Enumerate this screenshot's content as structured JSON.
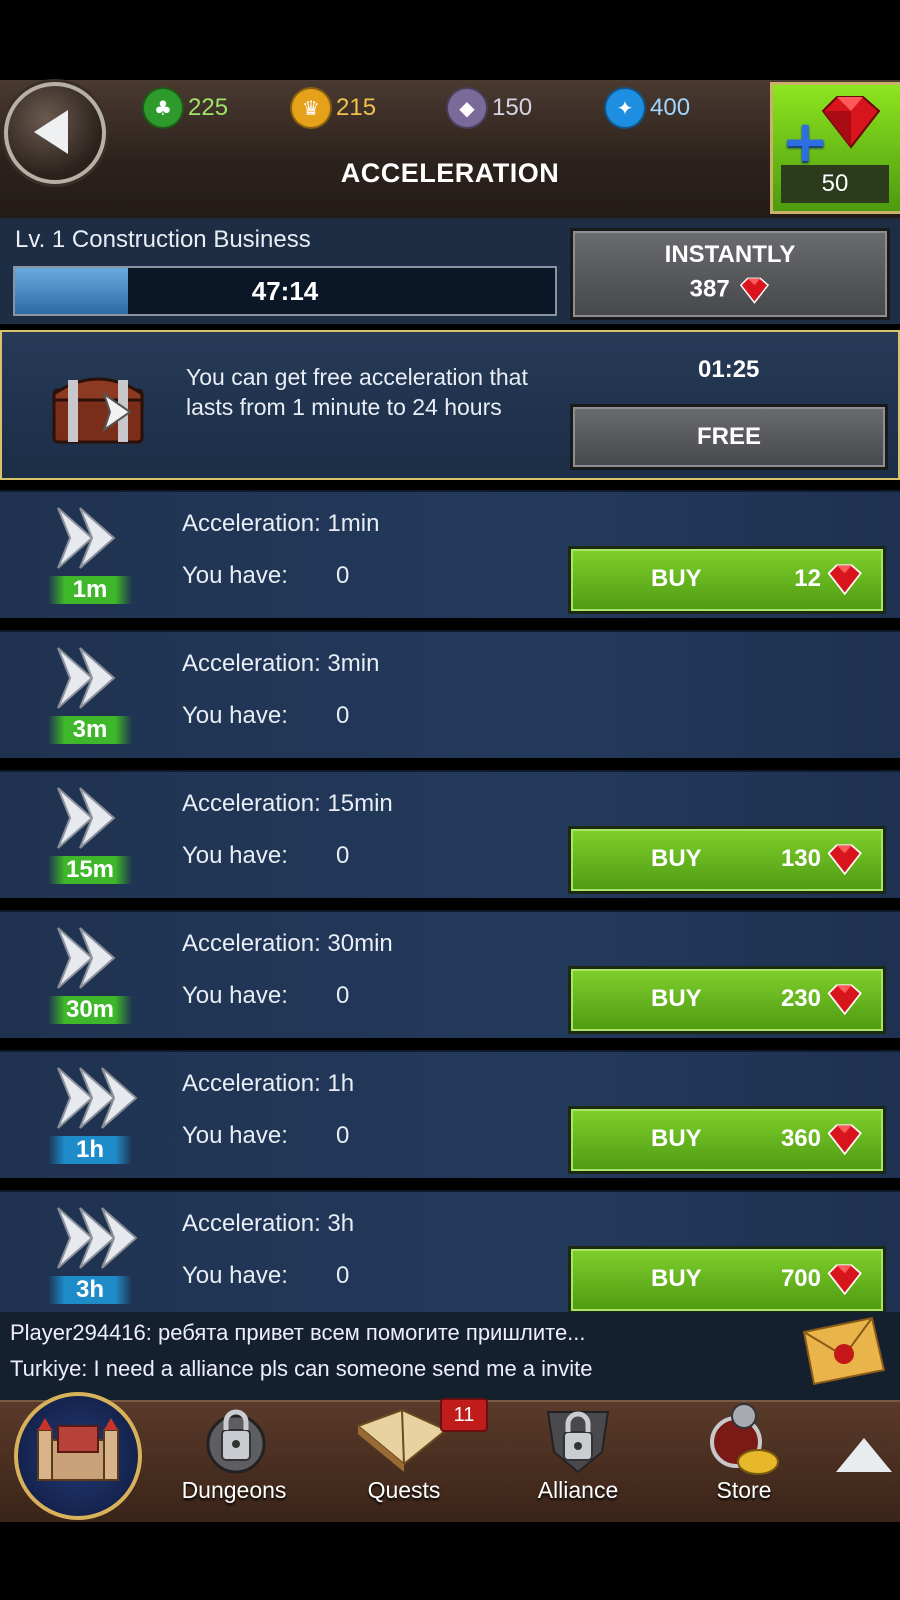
{
  "header": {
    "title": "ACCELERATION",
    "resources": [
      {
        "name": "wood",
        "icon": "tree-icon",
        "value": "225",
        "color": "#2e9a2b"
      },
      {
        "name": "gold",
        "icon": "crown-icon",
        "value": "215",
        "color": "#e6a11a"
      },
      {
        "name": "stone",
        "icon": "crystal-icon",
        "value": "150",
        "color": "#7a6a9a"
      },
      {
        "name": "mana",
        "icon": "star-icon",
        "value": "400",
        "color": "#1e8ee0"
      }
    ],
    "gems": "50"
  },
  "progress": {
    "label": "Lv. 1 Construction Business",
    "time": "47:14",
    "fill": 0.21,
    "instant_label": "INSTANTLY",
    "instant_cost": "387"
  },
  "free": {
    "text": "You can get free acceleration that lasts from 1 minute to 24 hours",
    "timer": "01:25",
    "button": "FREE"
  },
  "rows": [
    {
      "tag": "1m",
      "tag_color": "green",
      "name": "Acceleration: 1min",
      "have_label": "You have:",
      "have": "0",
      "buy": "BUY",
      "price": "12",
      "show_buy": true
    },
    {
      "tag": "3m",
      "tag_color": "green",
      "name": "Acceleration: 3min",
      "have_label": "You have:",
      "have": "0",
      "buy": "",
      "price": "",
      "show_buy": false
    },
    {
      "tag": "15m",
      "tag_color": "green",
      "name": "Acceleration: 15min",
      "have_label": "You have:",
      "have": "0",
      "buy": "BUY",
      "price": "130",
      "show_buy": true
    },
    {
      "tag": "30m",
      "tag_color": "green",
      "name": "Acceleration: 30min",
      "have_label": "You have:",
      "have": "0",
      "buy": "BUY",
      "price": "230",
      "show_buy": true
    },
    {
      "tag": "1h",
      "tag_color": "blue",
      "name": "Acceleration: 1h",
      "have_label": "You have:",
      "have": "0",
      "buy": "BUY",
      "price": "360",
      "show_buy": true
    },
    {
      "tag": "3h",
      "tag_color": "blue",
      "name": "Acceleration: 3h",
      "have_label": "You have:",
      "have": "0",
      "buy": "BUY",
      "price": "700",
      "show_buy": true
    }
  ],
  "chat": [
    "Player294416: ребята привет всем помогите пришлите...",
    "Turkiye: I need a alliance pls can someone send me a invite"
  ],
  "nav": {
    "dungeons": "Dungeons",
    "quests": "Quests",
    "quests_badge": "11",
    "alliance": "Alliance",
    "store": "Store"
  }
}
